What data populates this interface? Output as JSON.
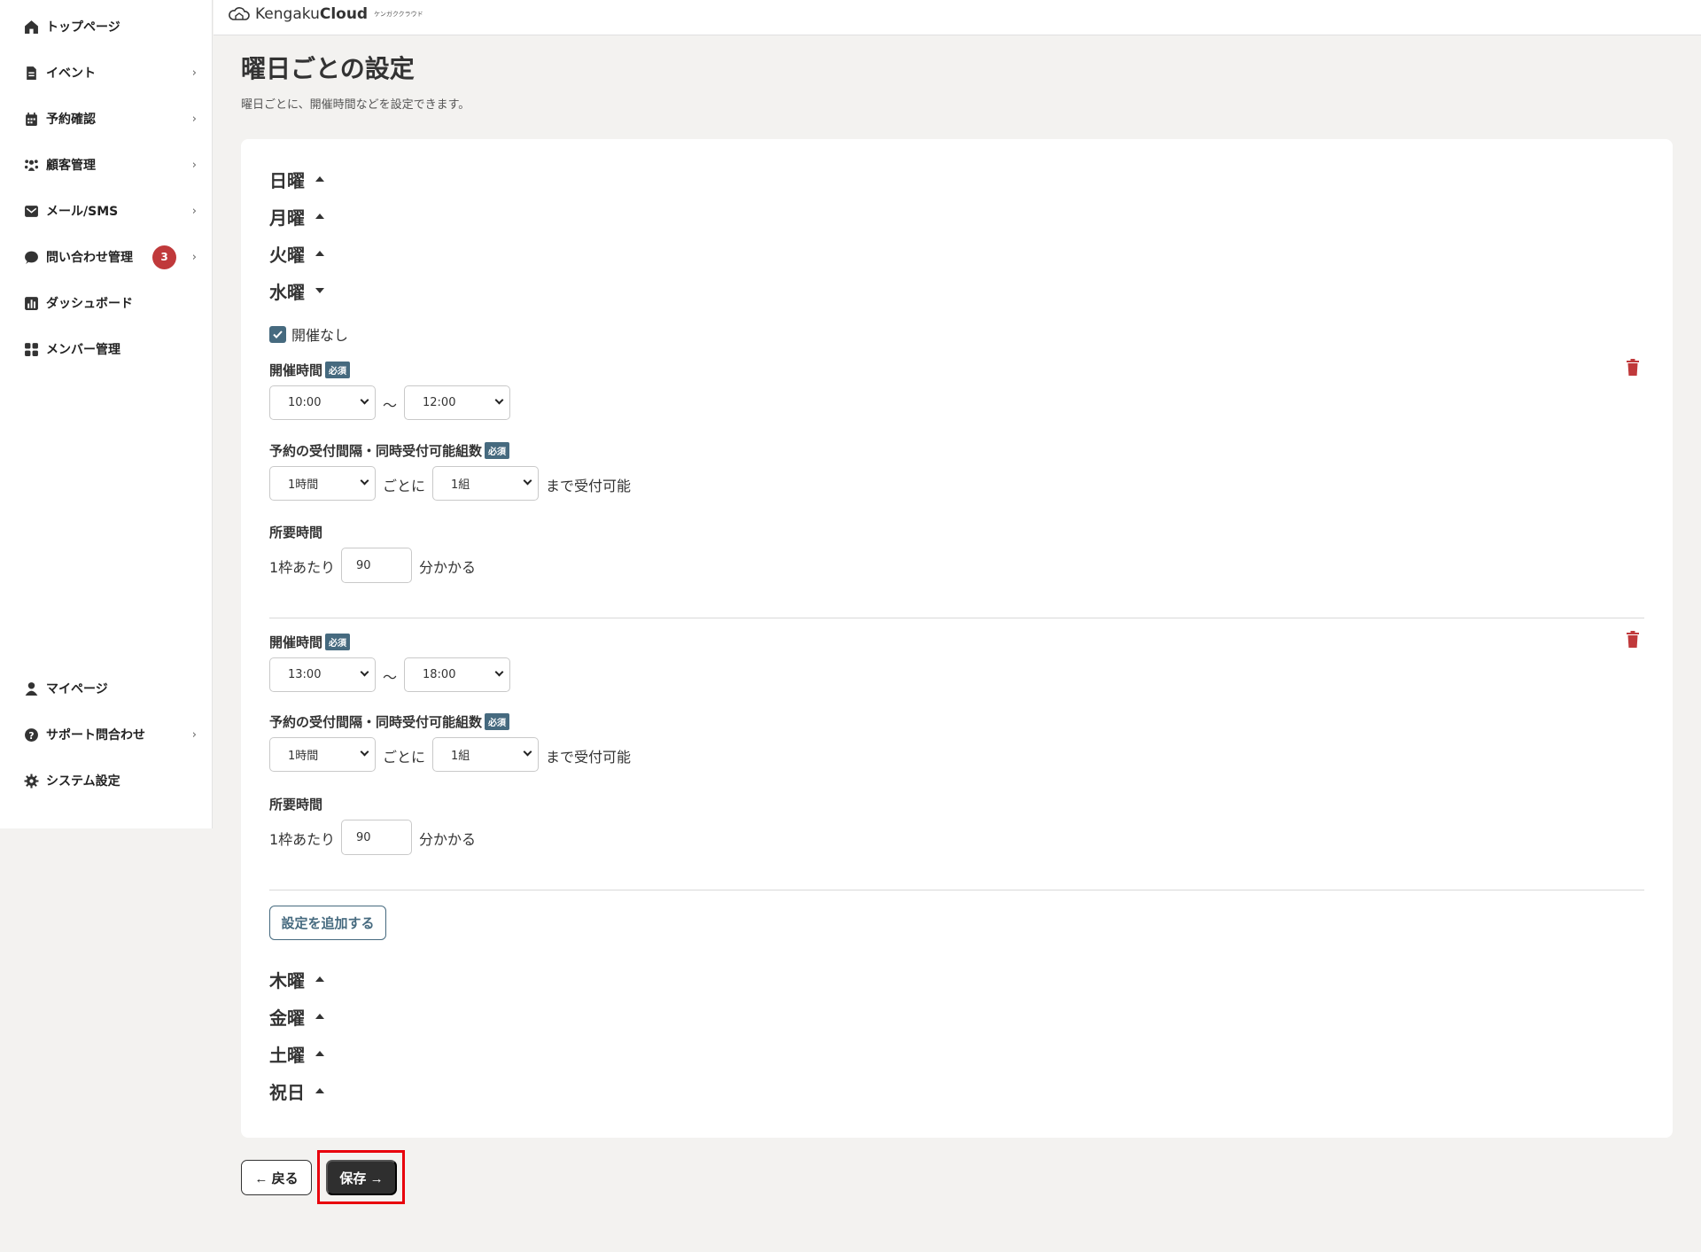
{
  "app": {
    "brand_main": "Kengaku",
    "brand_bold": "Cloud",
    "brand_kana": "ケンガククラウド"
  },
  "sidebar": {
    "items": [
      {
        "label": "トップページ",
        "icon": "home-icon",
        "chevron": ""
      },
      {
        "label": "イベント",
        "icon": "document-icon",
        "chevron": "›"
      },
      {
        "label": "予約確認",
        "icon": "calendar-icon",
        "chevron": "›"
      },
      {
        "label": "顧客管理",
        "icon": "users-icon",
        "chevron": "›"
      },
      {
        "label": "メール/SMS",
        "icon": "mail-icon",
        "chevron": "›"
      },
      {
        "label": "問い合わせ管理",
        "icon": "chat-icon",
        "chevron": "›",
        "badge": "3"
      },
      {
        "label": "ダッシュボード",
        "icon": "chart-icon",
        "chevron": ""
      },
      {
        "label": "メンバー管理",
        "icon": "grid-icon",
        "chevron": ""
      },
      {
        "label": "マイページ",
        "icon": "user-icon",
        "chevron": ""
      },
      {
        "label": "サポート問合わせ",
        "icon": "help-icon",
        "chevron": "›"
      },
      {
        "label": "システム設定",
        "icon": "gear-icon",
        "chevron": ""
      }
    ],
    "badge_color": "#c0393b"
  },
  "page": {
    "title": "曜日ごとの設定",
    "subtitle": "曜日ごとに、開催時間などを設定できます。"
  },
  "days": {
    "sun": "日曜",
    "mon": "月曜",
    "tue": "火曜",
    "wed": "水曜",
    "thu": "木曜",
    "fri": "金曜",
    "sat": "土曜",
    "hol": "祝日"
  },
  "wednesday": {
    "no_event_label": "開催なし",
    "no_event_checked": true,
    "slots": [
      {
        "time_label": "開催時間",
        "required": "必須",
        "start": "10:00",
        "tilde": "〜",
        "end": "12:00",
        "interval_label": "予約の受付間隔・同時受付可能組数",
        "interval": "1時間",
        "every": "ごとに",
        "groups": "1組",
        "until": "まで受付可能",
        "duration_label": "所要時間",
        "per_slot": "1枠あたり",
        "minutes": "90",
        "takes": "分かかる"
      },
      {
        "time_label": "開催時間",
        "required": "必須",
        "start": "13:00",
        "tilde": "〜",
        "end": "18:00",
        "interval_label": "予約の受付間隔・同時受付可能組数",
        "interval": "1時間",
        "every": "ごとに",
        "groups": "1組",
        "until": "まで受付可能",
        "duration_label": "所要時間",
        "per_slot": "1枠あたり",
        "minutes": "90",
        "takes": "分かかる"
      }
    ],
    "add_button": "設定を追加する"
  },
  "footer": {
    "back": "← 戻る",
    "save": "保存 →"
  },
  "colors": {
    "accent": "#466a7f",
    "delete": "#c0393b",
    "highlight": "#e8000c",
    "save_bg": "#2f2f2f"
  }
}
